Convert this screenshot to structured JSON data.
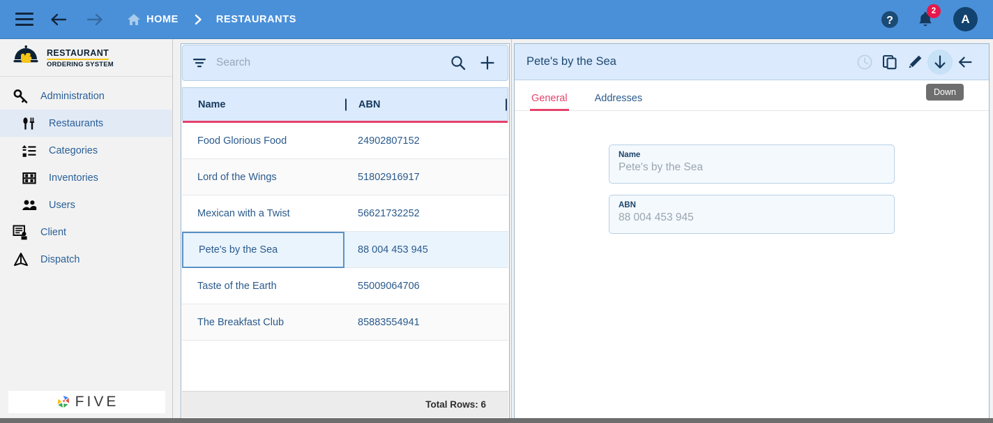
{
  "topbar": {
    "menu_icon": "hamburger-icon",
    "back_icon": "arrow-left-icon",
    "forward_icon": "arrow-right-icon",
    "home_label": "HOME",
    "breadcrumb_current": "RESTAURANTS",
    "help_icon": "help-circle-icon",
    "notifications_icon": "bell-icon",
    "notification_count": "2",
    "avatar_initial": "A",
    "background_color": "#4a90d9",
    "badge_color": "#e8174a"
  },
  "sidebar": {
    "brand": {
      "line1": "RESTAURANT",
      "line2": "ORDERING SYSTEM",
      "icon": "cloche-hand-icon"
    },
    "items": [
      {
        "label": "Administration",
        "icon": "key-icon",
        "level": 1,
        "active": false
      },
      {
        "label": "Restaurants",
        "icon": "fork-spoon-icon",
        "level": 2,
        "active": true
      },
      {
        "label": "Categories",
        "icon": "list-bullet-icon",
        "level": 2,
        "active": false
      },
      {
        "label": "Inventories",
        "icon": "shelf-icon",
        "level": 2,
        "active": false
      },
      {
        "label": "Users",
        "icon": "people-icon",
        "level": 2,
        "active": false
      },
      {
        "label": "Client",
        "icon": "client-card-icon",
        "level": 1,
        "active": false
      },
      {
        "label": "Dispatch",
        "icon": "dispatch-triangle-icon",
        "level": 1,
        "active": false
      }
    ],
    "footer_logo_text": "FIVE"
  },
  "list_panel": {
    "search": {
      "placeholder": "Search",
      "value": "",
      "filter_icon": "filter-icon",
      "search_icon": "search-icon",
      "add_icon": "plus-icon"
    },
    "columns": [
      "Name",
      "ABN"
    ],
    "rows": [
      {
        "name": "Food Glorious Food",
        "abn": "24902807152",
        "selected": false
      },
      {
        "name": "Lord of the Wings",
        "abn": "51802916917",
        "selected": false
      },
      {
        "name": "Mexican with a Twist",
        "abn": "56621732252",
        "selected": false
      },
      {
        "name": "Pete's by the Sea",
        "abn": "88 004 453 945",
        "selected": true
      },
      {
        "name": "Taste of the Earth",
        "abn": "55009064706",
        "selected": false
      },
      {
        "name": "The Breakfast Club",
        "abn": "85883554941",
        "selected": false
      }
    ],
    "footer": {
      "total_rows_label": "Total Rows: 6"
    },
    "accent_color": "#e5426a",
    "header_background": "#dbeafc"
  },
  "detail_panel": {
    "title": "Pete's by the Sea",
    "actions": [
      {
        "name": "history-clock-icon",
        "disabled": true
      },
      {
        "name": "copy-icon",
        "disabled": false
      },
      {
        "name": "pencil-edit-icon",
        "disabled": false
      },
      {
        "name": "arrow-down-icon",
        "disabled": false,
        "highlighted": true
      },
      {
        "name": "arrow-left-back-icon",
        "disabled": false
      }
    ],
    "tabs": [
      {
        "label": "General",
        "active": true
      },
      {
        "label": "Addresses",
        "active": false
      }
    ],
    "tooltip": "Down",
    "fields": [
      {
        "label": "Name",
        "value": "Pete's by the Sea"
      },
      {
        "label": "ABN",
        "value": "88 004 453 945"
      }
    ]
  }
}
